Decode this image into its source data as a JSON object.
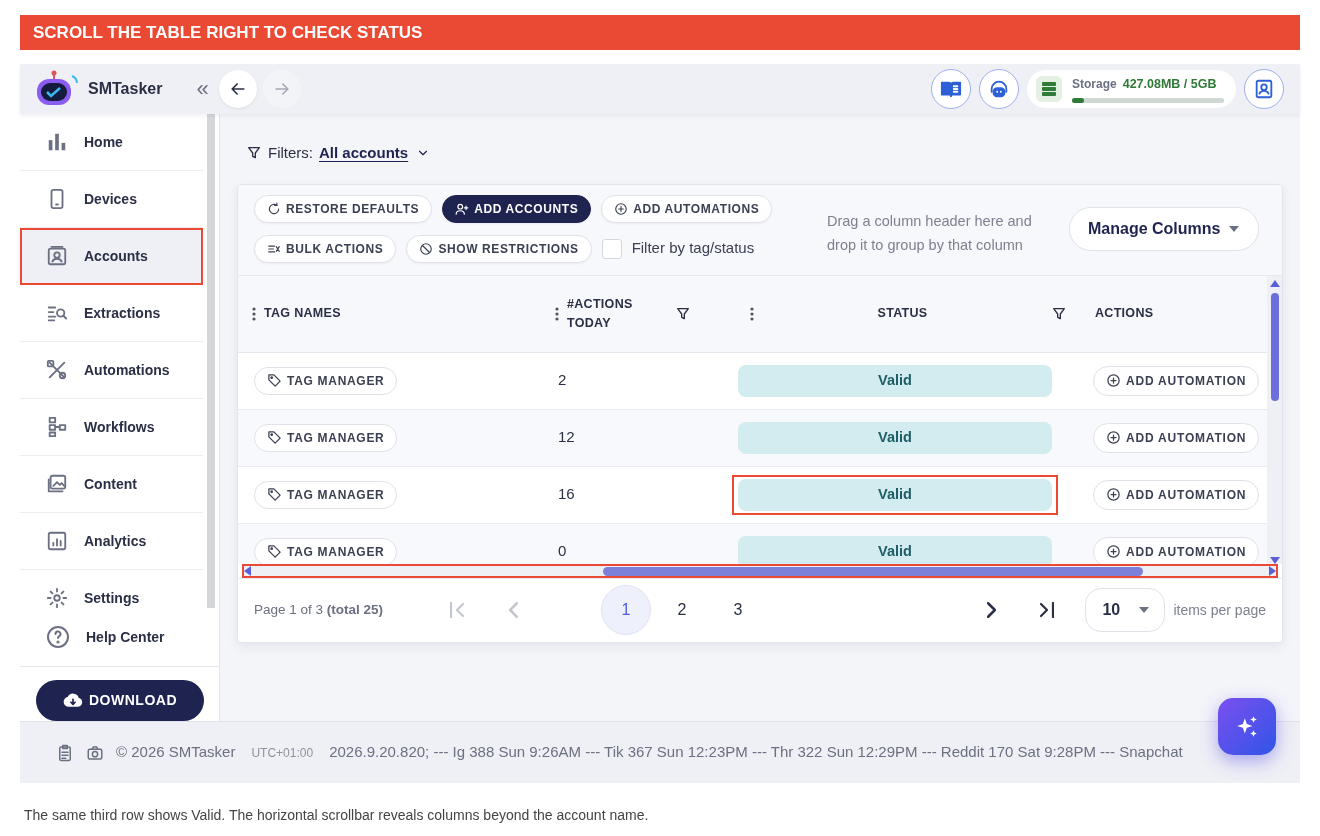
{
  "banner": {
    "title": "SCROLL THE TABLE RIGHT TO CHECK STATUS"
  },
  "header": {
    "app_name": "SMTasker",
    "collapse": "«",
    "history": [
      {
        "kind": "back",
        "disabled": false
      },
      {
        "kind": "forward",
        "disabled": true
      }
    ],
    "storage": {
      "label": "Storage",
      "value": "427.08MB / 5GB",
      "level": 0.08
    }
  },
  "sidebar": {
    "items": [
      {
        "label": "Home",
        "selected": false,
        "highlighted": false
      },
      {
        "label": "Devices",
        "selected": false,
        "highlighted": false
      },
      {
        "label": "Accounts",
        "selected": true,
        "highlighted": true
      },
      {
        "label": "Extractions",
        "selected": false,
        "highlighted": false
      },
      {
        "label": "Automations",
        "selected": false,
        "highlighted": false
      },
      {
        "label": "Workflows",
        "selected": false,
        "highlighted": false
      },
      {
        "label": "Content",
        "selected": false,
        "highlighted": false
      },
      {
        "label": "Analytics",
        "selected": false,
        "highlighted": false
      },
      {
        "label": "Settings",
        "selected": false,
        "highlighted": false
      }
    ],
    "help": "Help Center",
    "download": "DOWNLOAD"
  },
  "filters": {
    "label": "Filters:",
    "value": "All accounts"
  },
  "toolbar": {
    "buttons": [
      {
        "label": "RESTORE DEFAULTS",
        "primary": false
      },
      {
        "label": "ADD ACCOUNTS",
        "primary": true
      },
      {
        "label": "ADD AUTOMATIONS",
        "primary": false
      },
      {
        "label": "BULK ACTIONS",
        "primary": false
      },
      {
        "label": "SHOW RESTRICTIONS",
        "primary": false
      }
    ],
    "checkbox": {
      "label": "Filter by tag/status",
      "checked": false
    },
    "group_hint": "Drag a column header here and drop it to group by that column",
    "manage_columns": "Manage Columns"
  },
  "table": {
    "columns": [
      {
        "label": "TAG NAMES",
        "menu": true,
        "filter": false
      },
      {
        "label": "#ACTIONS TODAY",
        "menu": true,
        "filter": true
      },
      {
        "label": "STATUS",
        "menu": true,
        "filter": true
      },
      {
        "label": "ACTIONS",
        "menu": false,
        "filter": false
      }
    ],
    "rows": [
      {
        "tag": "TAG MANAGER",
        "actions_today": "2",
        "status": "Valid",
        "action": "ADD AUTOMATION",
        "highlighted": false
      },
      {
        "tag": "TAG MANAGER",
        "actions_today": "12",
        "status": "Valid",
        "action": "ADD AUTOMATION",
        "highlighted": false
      },
      {
        "tag": "TAG MANAGER",
        "actions_today": "16",
        "status": "Valid",
        "action": "ADD AUTOMATION",
        "highlighted": true
      },
      {
        "tag": "TAG MANAGER",
        "actions_today": "0",
        "status": "Valid",
        "action": "ADD AUTOMATION",
        "highlighted": false
      }
    ],
    "scrollbar_highlighted": true
  },
  "pager": {
    "summary": "Page 1 of 3 **(total 25)**",
    "back_buttons": [
      {
        "kind": "first",
        "disabled": true
      },
      {
        "kind": "prev",
        "disabled": true
      }
    ],
    "pages": [
      {
        "label": "1",
        "selected": true
      },
      {
        "label": "2",
        "selected": false
      },
      {
        "label": "3",
        "selected": false
      }
    ],
    "forward_buttons": [
      {
        "kind": "next",
        "disabled": false
      },
      {
        "kind": "last",
        "disabled": false
      }
    ],
    "per_page": "10",
    "per_page_label": "items per page"
  },
  "footer": {
    "copyright": "© 2026 SMTasker",
    "timezone": "UTC+01:00",
    "ticker": "2026.9.20.820; --- Ig 388 Sun 9:26AM --- Tik 367 Sun 12:23PM --- Thr 322 Sun 12:29PM --- Reddit 170 Sat 9:28PM --- Snapchat"
  },
  "caption": "The same third row shows Valid. The horizontal scrollbar reveals columns beyond the account name."
}
